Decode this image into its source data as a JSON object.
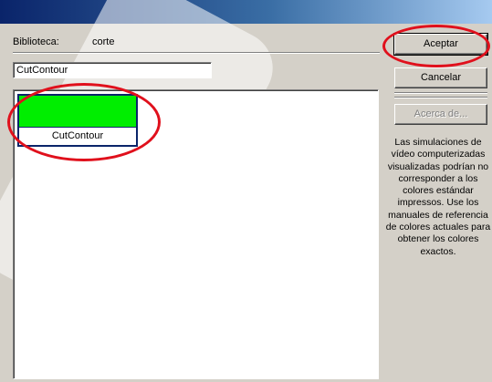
{
  "window": {
    "title_color": "#0a246a"
  },
  "library": {
    "label": "Biblioteca:",
    "value": "corte"
  },
  "name_field": {
    "value": "CutContour"
  },
  "swatches": [
    {
      "name": "CutContour",
      "color": "#00ee00",
      "selected": true
    }
  ],
  "buttons": {
    "ok": "Aceptar",
    "cancel": "Cancelar",
    "about": "Acerca de..."
  },
  "note": "Las simulaciones de vídeo computerizadas visualizadas podrían no corresponder a los colores estándar impressos.  Use los manuales de referencia de colores actuales para obtener los colores exactos.",
  "annotations": {
    "highlight_color": "#e0101c"
  }
}
